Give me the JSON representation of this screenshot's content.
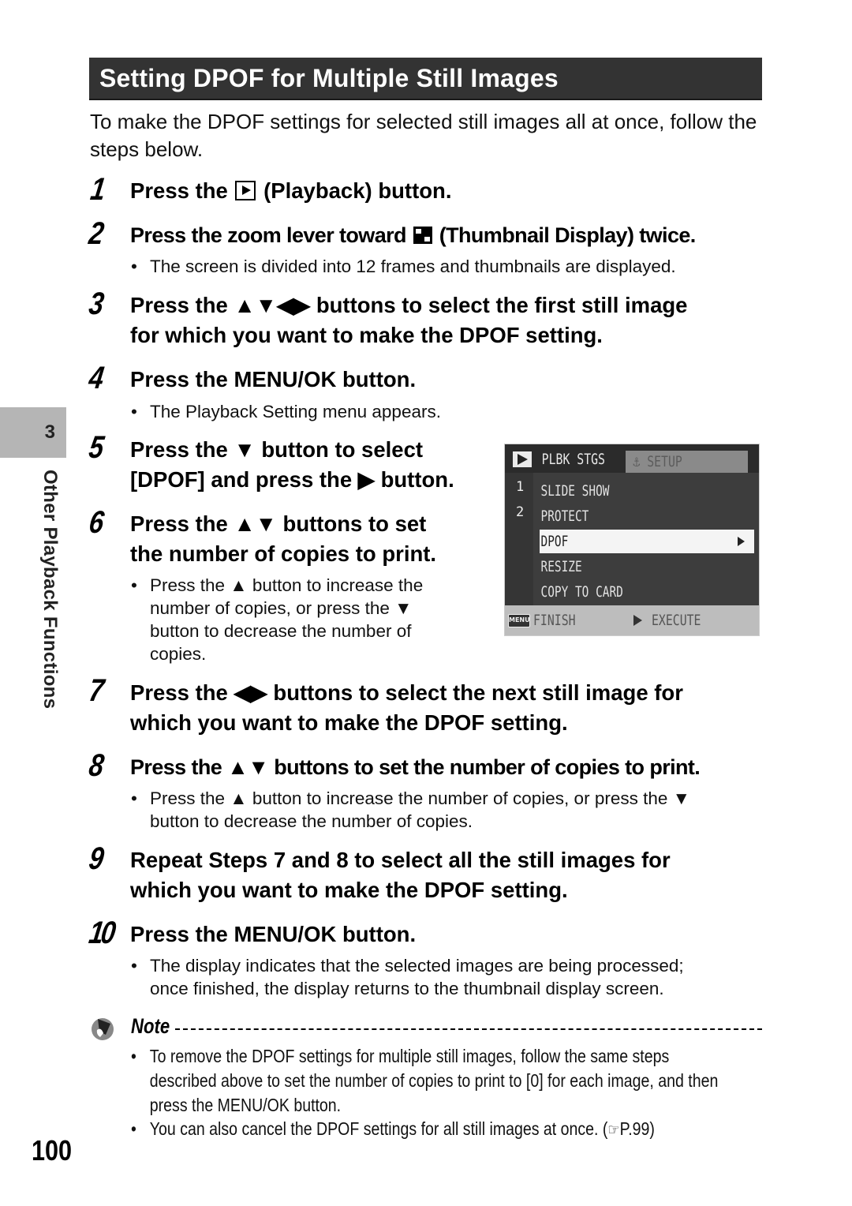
{
  "section": {
    "title": "Setting DPOF for Multiple Still Images",
    "intro": "To make the DPOF settings for selected still images all at once, follow the steps below."
  },
  "side_tab": {
    "chapter_number": "3",
    "chapter_title": "Other Playback Functions"
  },
  "steps": [
    {
      "num": "1",
      "pre": "Press the ",
      "icon": "playback-button-icon",
      "post": " (Playback) button.",
      "bullets": []
    },
    {
      "num": "2",
      "pre": "Press the zoom lever toward ",
      "icon": "thumbnail-display-icon",
      "post": " (Thumbnail Display) twice.",
      "bullets": [
        "The screen is divided into 12 frames and thumbnails are displayed."
      ]
    },
    {
      "num": "3",
      "line1": "Press the ▲▼◀▶ buttons to select the first still image",
      "line2": "for which you want to make the DPOF setting.",
      "bullets": []
    },
    {
      "num": "4",
      "title": "Press the MENU/OK button.",
      "bullets": [
        "The Playback Setting menu appears."
      ]
    },
    {
      "num": "5",
      "line1": "Press the ▼ button to select",
      "line2": "[DPOF] and press the ▶ button.",
      "bullets": []
    },
    {
      "num": "6",
      "line1": "Press the ▲▼ buttons to set",
      "line2": "the number of copies to print.",
      "bullets": [
        "Press the ▲ button to increase the",
        "number of copies, or press the ▼",
        "button to decrease the number of",
        "copies."
      ]
    },
    {
      "num": "7",
      "line1": "Press the ◀▶ buttons to select the next still image for",
      "line2": "which you want to make the DPOF setting.",
      "bullets": []
    },
    {
      "num": "8",
      "title": "Press the ▲▼ buttons to set the number of copies to print.",
      "bullets": [
        "Press the ▲ button to increase the number of copies, or press the ▼",
        "button to decrease the number of copies."
      ]
    },
    {
      "num": "9",
      "line1": "Repeat Steps 7 and 8 to select all the still images for",
      "line2": "which you want to make the DPOF setting.",
      "bullets": []
    },
    {
      "num": "10",
      "title": "Press the MENU/OK button.",
      "bullets": [
        "The display indicates that the selected images are being processed;",
        "once finished, the display returns to the thumbnail display screen."
      ]
    }
  ],
  "camera_screen": {
    "active_tab": "PLBK STGS",
    "inactive_tab": "⚓ SETUP",
    "pages": [
      "1",
      "2"
    ],
    "menu_items": [
      "SLIDE SHOW",
      "PROTECT",
      "DPOF",
      "RESIZE",
      "COPY TO CARD"
    ],
    "selected_item": "DPOF",
    "footer_menu_icon": "MENU",
    "footer_left": "FINISH",
    "footer_right": "EXECUTE"
  },
  "note": {
    "heading": "Note",
    "bullets": [
      {
        "line1": "To remove the DPOF settings for multiple still images, follow the same steps",
        "line2": "described above to set the number of copies to print to [0] for each image, and then",
        "line3": "press the MENU/OK button."
      },
      {
        "line1": "You can also cancel the DPOF settings for all still images at once. (",
        "ref_icon": "☞",
        "ref": "P.99)"
      }
    ]
  },
  "page_number": "100",
  "bullet_char": "•"
}
